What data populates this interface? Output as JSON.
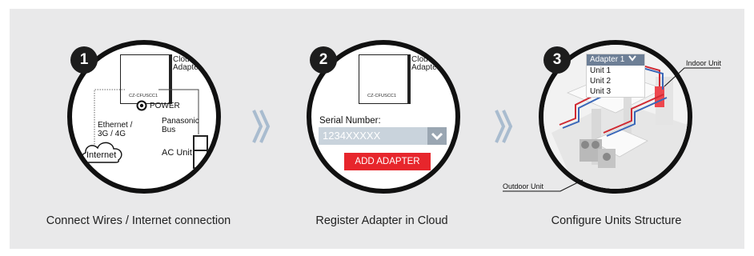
{
  "steps": [
    {
      "number": "1",
      "caption": "Connect Wires / Internet connection",
      "device_model": "CZ-CFUSCC1",
      "cloud_adapter_label": [
        "Cloud",
        "Adapter"
      ],
      "power_label": "POWER",
      "ethernet_label": [
        "Ethernet /",
        "3G / 4G"
      ],
      "bus_label": [
        "Panasonic",
        "Bus"
      ],
      "internet_label": "Internet",
      "ac_unit_label": "AC Unit"
    },
    {
      "number": "2",
      "caption": "Register Adapter in Cloud",
      "device_model": "CZ-CFUSCC1",
      "cloud_adapter_label": [
        "Cloud",
        "Adapter"
      ],
      "serial_label": "Serial Number:",
      "serial_value": "1234XXXXX",
      "add_button": "ADD ADAPTER"
    },
    {
      "number": "3",
      "caption": "Configure Units Structure",
      "dropdown_selected": "Adapter 1",
      "dropdown_items": [
        "Unit 1",
        "Unit 2",
        "Unit 3"
      ],
      "indoor_label": "Indoor Unit",
      "outdoor_label": "Outdoor Unit"
    }
  ],
  "colors": {
    "panel_bg": "#e9e9ea",
    "chevron": "#a9bccf",
    "accent_red": "#e7262c",
    "serial_field": "#c9d3dc",
    "dropdown_header": "#6d7f96"
  },
  "icons": [
    "chevron-right-icon",
    "cloud-icon",
    "power-button-icon",
    "chevron-down-icon"
  ]
}
